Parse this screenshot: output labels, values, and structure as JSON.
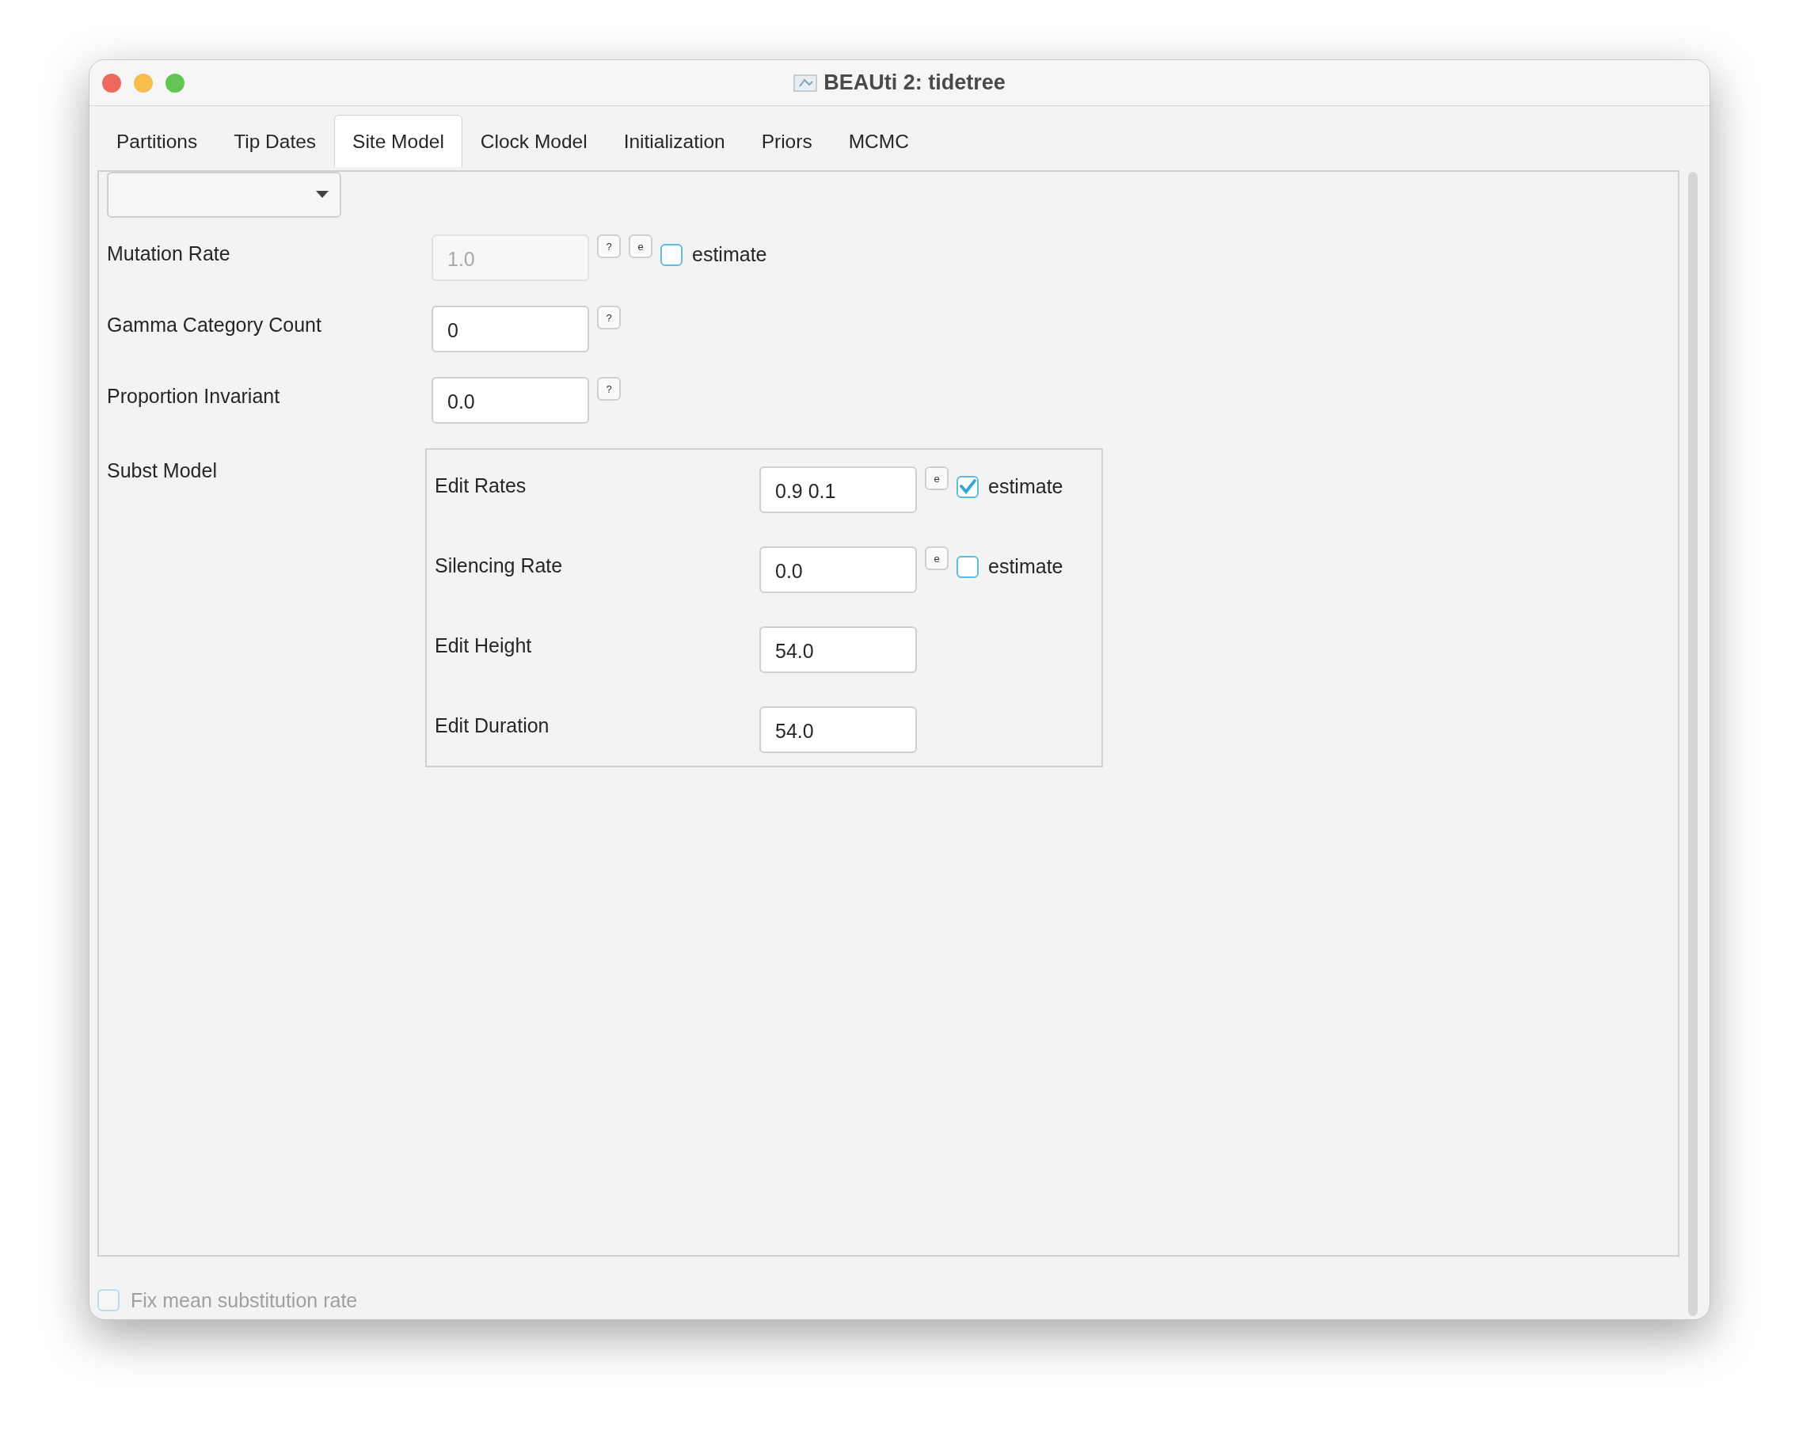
{
  "window": {
    "title": "BEAUti 2: tidetree"
  },
  "tabs": [
    {
      "label": "Partitions",
      "selected": false
    },
    {
      "label": "Tip Dates",
      "selected": false
    },
    {
      "label": "Site Model",
      "selected": true
    },
    {
      "label": "Clock Model",
      "selected": false
    },
    {
      "label": "Initialization",
      "selected": false
    },
    {
      "label": "Priors",
      "selected": false
    },
    {
      "label": "MCMC",
      "selected": false
    }
  ],
  "fields": [
    {
      "label": "Mutation Rate",
      "value": "1.0",
      "disabled": true,
      "buttons": [
        "?",
        "e"
      ],
      "estimate": {
        "label": "estimate",
        "checked": false
      }
    },
    {
      "label": "Gamma Category Count",
      "value": "0",
      "disabled": false,
      "buttons": [
        "?"
      ]
    },
    {
      "label": "Proportion Invariant",
      "value": "0.0",
      "disabled": false,
      "buttons": [
        "?"
      ]
    }
  ],
  "subst_model": {
    "label": "Subst Model",
    "fields": [
      {
        "label": "Edit Rates",
        "value": "0.9 0.1",
        "disabled": false,
        "buttons": [
          "e"
        ],
        "estimate": {
          "label": "estimate",
          "checked": true
        }
      },
      {
        "label": "Silencing Rate",
        "value": "0.0",
        "disabled": false,
        "buttons": [
          "e"
        ],
        "estimate": {
          "label": "estimate",
          "checked": false
        }
      },
      {
        "label": "Edit Height",
        "value": "54.0",
        "disabled": false
      },
      {
        "label": "Edit Duration",
        "value": "54.0",
        "disabled": false
      }
    ]
  },
  "footer": {
    "label": "Fix mean substitution rate",
    "checked": false,
    "disabled": true
  }
}
